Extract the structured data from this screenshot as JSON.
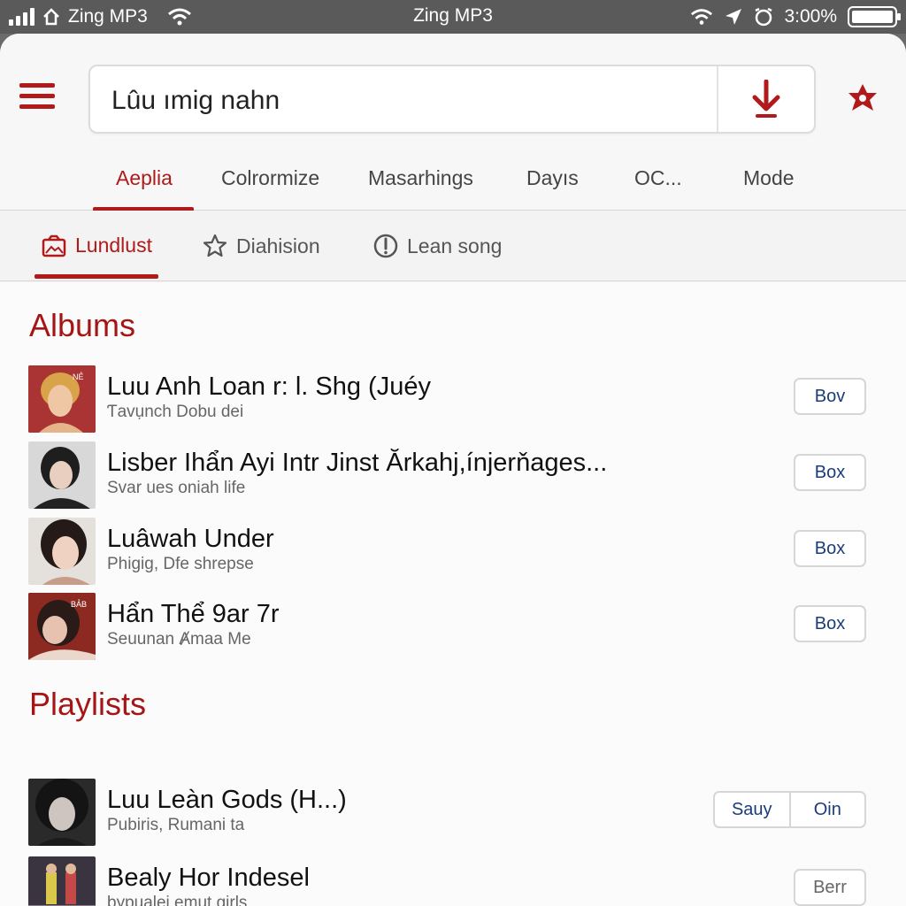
{
  "status_bar": {
    "left_app": "Zing MP3",
    "title": "Zing MP3",
    "battery": "3:00%",
    "signal_bars": 4
  },
  "header": {
    "search_value": "Lûu ımig nahn",
    "icons": {
      "menu": "hamburger-menu-icon",
      "mic": "download-arrow-icon",
      "star": "star-badge-icon"
    }
  },
  "tabs": [
    {
      "label": "Aeplia",
      "active": true
    },
    {
      "label": "Colrormize",
      "active": false
    },
    {
      "label": "Masarhings",
      "active": false
    },
    {
      "label": "Dayıs",
      "active": false
    },
    {
      "label": "OC...",
      "active": false
    },
    {
      "label": "Mode",
      "active": false
    }
  ],
  "subtabs": [
    {
      "label": "Lundlust",
      "icon": "photo-icon",
      "active": true
    },
    {
      "label": "Diahision",
      "icon": "star-icon",
      "active": false
    },
    {
      "label": "Lean song",
      "icon": "download-circle-icon",
      "active": false
    }
  ],
  "albums": {
    "title": "Albums",
    "items": [
      {
        "title": "Luu Anh Loan r: l. Shg (Juéy",
        "subtitle": "Ƭavụnch Dobu dei",
        "button": "Bov"
      },
      {
        "title": "Lisber Ihẩn Ayi Intr Jinst Ărkahj,ínjerňages...",
        "subtitle": "Svar ues oniah life",
        "button": "Box"
      },
      {
        "title": "Luâwah Under",
        "subtitle": "Phigig, Dfe shrepse",
        "button": "Box"
      },
      {
        "title": "Hẩn Thể 9ar 7r",
        "subtitle": "Seuunan Ⱥmaa Me",
        "button": "Box"
      }
    ]
  },
  "playlists": {
    "title": "Playlists",
    "items": [
      {
        "title": "Luu Leàn Gods (H...)",
        "subtitle": "Pubiris, Rumani ta",
        "buttons": [
          "Sauy",
          "Oin"
        ]
      },
      {
        "title": "Bealy Hor Indesel",
        "subtitle": "bypualei emut girls",
        "button": "Berr"
      }
    ]
  },
  "colors": {
    "accent": "#b01a1a",
    "button_text": "#1a3d7a"
  }
}
